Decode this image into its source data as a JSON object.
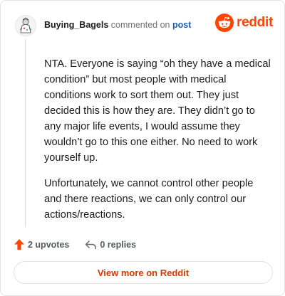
{
  "comment": {
    "username": "Buying_Bagels",
    "meta_text": "commented on",
    "post_link": "post",
    "paragraphs": [
      "NTA. Everyone is saying “oh they have a medical condition” but most people with medical conditions work to sort them out. They just decided this is how they are. They didn’t go to any major life events, I would assume they wouldn’t go to this one either. No need to work yourself up.",
      "Unfortunately, we cannot control other people and there reactions, we can only control our actions/reactions."
    ]
  },
  "logo": {
    "text": "reddit",
    "icon": "reddit-snoo-icon",
    "color": "#ff4500"
  },
  "actions": {
    "upvotes_label": "2 upvotes",
    "replies_label": "0 replies"
  },
  "cta": {
    "label": "View more on Reddit"
  },
  "colors": {
    "accent": "#ff4500",
    "link": "#1a5fb4",
    "cta_text": "#d93900"
  }
}
